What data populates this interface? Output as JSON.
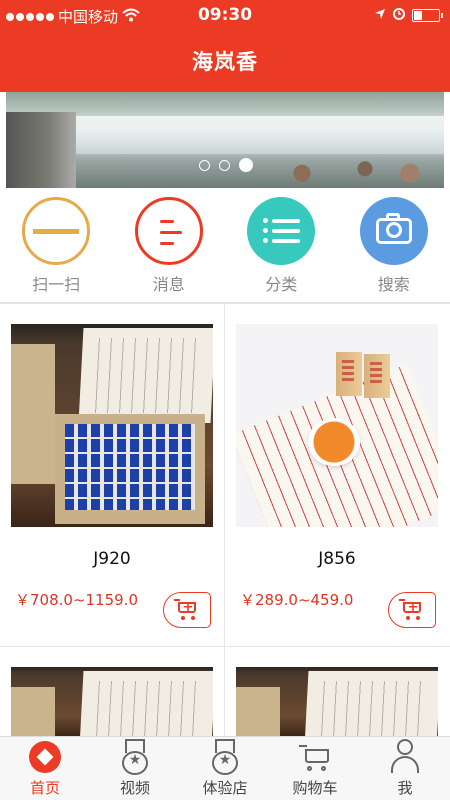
{
  "status_bar": {
    "carrier": "中国移动",
    "time": "09:30"
  },
  "header": {
    "title": "海岚香"
  },
  "banner": {
    "slide_count": 3,
    "active_index": 2
  },
  "menu": [
    {
      "label": "扫一扫",
      "icon": "scan-icon",
      "color": "#e8a94b"
    },
    {
      "label": "消息",
      "icon": "message-icon",
      "color": "#ec3b24"
    },
    {
      "label": "分类",
      "icon": "category-list-icon",
      "color": "#37c9bd"
    },
    {
      "label": "搜索",
      "icon": "camera-search-icon",
      "color": "#5b9be0"
    }
  ],
  "products": [
    {
      "name": "J920",
      "price": "￥708.0~1159.0"
    },
    {
      "name": "J856",
      "price": "￥289.0~459.0"
    }
  ],
  "tabbar": {
    "active": "首页",
    "items": [
      {
        "label": "首页",
        "icon": "home-icon"
      },
      {
        "label": "视频",
        "icon": "medal-icon"
      },
      {
        "label": "体验店",
        "icon": "medal-icon"
      },
      {
        "label": "购物车",
        "icon": "cart-icon"
      },
      {
        "label": "我",
        "icon": "user-icon"
      }
    ]
  },
  "colors": {
    "brand": "#ec3b24",
    "price": "#e03425"
  }
}
